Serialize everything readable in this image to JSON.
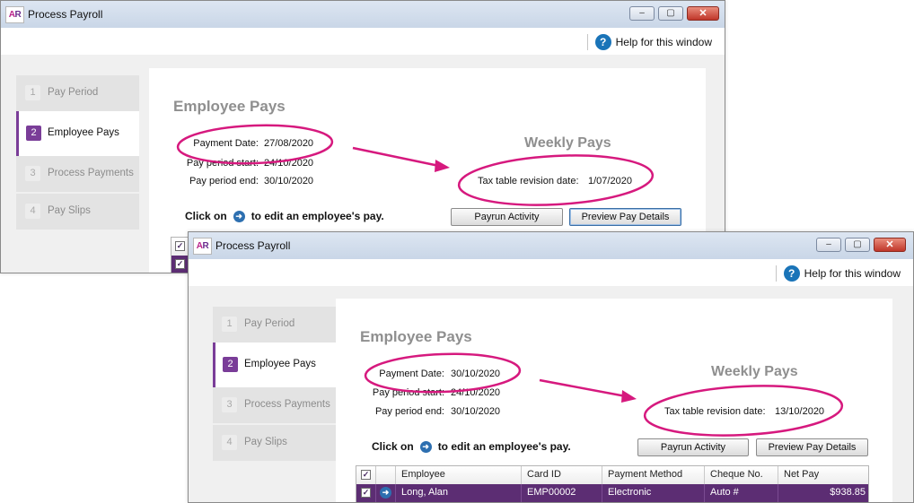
{
  "window_back": {
    "logo": {
      "a": "A",
      "r": "R"
    },
    "title": "Process Payroll",
    "controls": {
      "minimize": "–",
      "maximize": "▢",
      "close": "✕"
    },
    "help": {
      "icon": "?",
      "label": "Help for this window"
    },
    "steps": [
      {
        "num": "1",
        "label": "Pay Period",
        "active": false
      },
      {
        "num": "2",
        "label": "Employee Pays",
        "active": true
      },
      {
        "num": "3",
        "label": "Process Payments",
        "active": false
      },
      {
        "num": "4",
        "label": "Pay Slips",
        "active": false
      }
    ],
    "section_title": "Employee Pays",
    "pay_frequency": "Weekly Pays",
    "payment_date_label": "Payment Date:",
    "payment_date": "27/08/2020",
    "period_start_label": "Pay period start:",
    "period_start": "24/10/2020",
    "period_end_label": "Pay period end:",
    "period_end": "30/10/2020",
    "tax_table_label": "Tax table revision date:",
    "tax_table_date": "1/07/2020",
    "click_on": "Click on",
    "click_suffix": "to edit an employee's pay.",
    "payrun_activity_button": "Payrun Activity",
    "preview_pay_details_button": "Preview Pay Details"
  },
  "window_front": {
    "logo": {
      "a": "A",
      "r": "R"
    },
    "title": "Process Payroll",
    "controls": {
      "minimize": "–",
      "maximize": "▢",
      "close": "✕"
    },
    "help": {
      "icon": "?",
      "label": "Help for this window"
    },
    "steps": [
      {
        "num": "1",
        "label": "Pay Period",
        "active": false
      },
      {
        "num": "2",
        "label": "Employee Pays",
        "active": true
      },
      {
        "num": "3",
        "label": "Process Payments",
        "active": false
      },
      {
        "num": "4",
        "label": "Pay Slips",
        "active": false
      }
    ],
    "section_title": "Employee Pays",
    "pay_frequency": "Weekly Pays",
    "payment_date_label": "Payment Date:",
    "payment_date": "30/10/2020",
    "period_start_label": "Pay period start:",
    "period_start": "24/10/2020",
    "period_end_label": "Pay period end:",
    "period_end": "30/10/2020",
    "tax_table_label": "Tax table revision date:",
    "tax_table_date": "13/10/2020",
    "click_on": "Click on",
    "click_suffix": "to edit an employee's pay.",
    "payrun_activity_button": "Payrun Activity",
    "preview_pay_details_button": "Preview Pay Details",
    "table": {
      "columns": [
        "Employee",
        "Card ID",
        "Payment Method",
        "Cheque No.",
        "Net Pay"
      ],
      "rows": [
        {
          "employee": "Long, Alan",
          "card_id": "EMP00002",
          "payment_method": "Electronic",
          "cheque_no": "Auto #",
          "net_pay": "$938.85",
          "selected": true
        }
      ]
    }
  },
  "colors": {
    "accent_purple": "#7a3d98",
    "selected_row": "#5c2d73",
    "annotation_magenta": "#d6197e",
    "help_blue": "#1a74b8"
  }
}
